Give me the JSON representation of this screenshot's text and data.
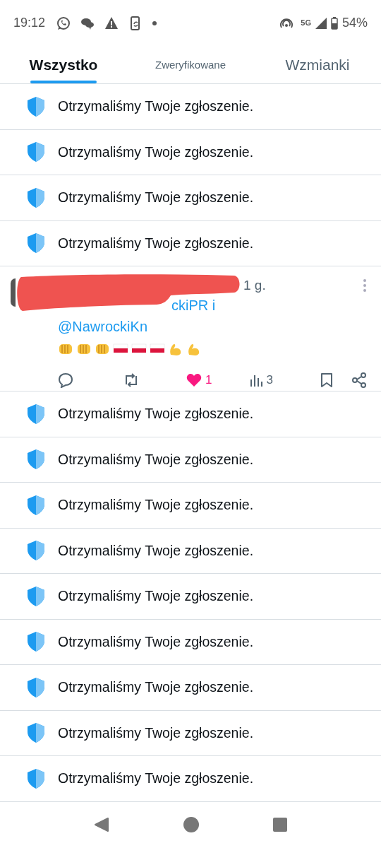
{
  "status_bar": {
    "time": "19:12",
    "notification_icons": [
      {
        "kind": "whatsapp"
      },
      {
        "kind": "chat"
      },
      {
        "kind": "warning"
      },
      {
        "kind": "phone"
      },
      {
        "kind": "dot"
      }
    ],
    "network": "5G",
    "battery": "54%"
  },
  "tabs": [
    {
      "label": "Wszystko",
      "selected": true,
      "kind": "standard"
    },
    {
      "label": "Zweryfikowane",
      "selected": false,
      "kind": "compact"
    },
    {
      "label": "Wzmianki",
      "selected": false,
      "kind": "standard"
    }
  ],
  "feed": [
    {
      "kind": "notice",
      "text": "Otrzymaliśmy Twoje zgłoszenie."
    },
    {
      "kind": "notice",
      "text": "Otrzymaliśmy Twoje zgłoszenie."
    },
    {
      "kind": "notice",
      "text": "Otrzymaliśmy Twoje zgłoszenie."
    },
    {
      "kind": "notice",
      "text": "Otrzymaliśmy Twoje zgłoszenie."
    },
    {
      "kind": "post",
      "time": "1 g.",
      "reply_to": [
        "ckiPR i",
        "@NawrockiKn"
      ],
      "emojis": [
        {
          "kind": "fist"
        },
        {
          "kind": "fist"
        },
        {
          "kind": "fist"
        },
        {
          "kind": "flag"
        },
        {
          "kind": "flag"
        },
        {
          "kind": "flag"
        },
        {
          "kind": "arm"
        },
        {
          "kind": "arm"
        }
      ],
      "likes": "1",
      "liked": true,
      "views": "3"
    },
    {
      "kind": "notice",
      "text": "Otrzymaliśmy Twoje zgłoszenie."
    },
    {
      "kind": "notice",
      "text": "Otrzymaliśmy Twoje zgłoszenie."
    },
    {
      "kind": "notice",
      "text": "Otrzymaliśmy Twoje zgłoszenie."
    },
    {
      "kind": "notice",
      "text": "Otrzymaliśmy Twoje zgłoszenie."
    },
    {
      "kind": "notice",
      "text": "Otrzymaliśmy Twoje zgłoszenie."
    },
    {
      "kind": "notice",
      "text": "Otrzymaliśmy Twoje zgłoszenie."
    },
    {
      "kind": "notice",
      "text": "Otrzymaliśmy Twoje zgłoszenie."
    },
    {
      "kind": "notice",
      "text": "Otrzymaliśmy Twoje zgłoszenie."
    },
    {
      "kind": "notice",
      "text": "Otrzymaliśmy Twoje zgłoszenie."
    }
  ]
}
